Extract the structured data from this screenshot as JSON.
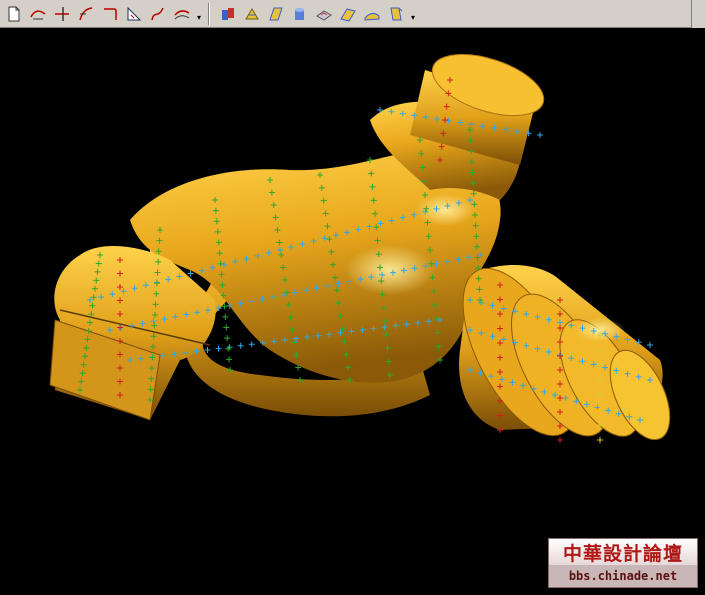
{
  "toolbar": {
    "left_tools": [
      {
        "icon": "new-sketch-icon"
      },
      {
        "icon": "curve-through-points-icon"
      },
      {
        "icon": "trim-curve-icon"
      },
      {
        "icon": "fillet-curve-icon"
      },
      {
        "icon": "corner-curve-icon"
      },
      {
        "icon": "project-curve-icon"
      },
      {
        "icon": "spline-icon"
      },
      {
        "icon": "offset-curve-icon"
      }
    ],
    "right_tools": [
      {
        "icon": "extrude-icon"
      },
      {
        "icon": "loft-surface-icon"
      },
      {
        "icon": "sweep-surface-icon"
      },
      {
        "icon": "solid-body-icon"
      },
      {
        "icon": "shell-icon"
      },
      {
        "icon": "blend-surface-icon"
      },
      {
        "icon": "boundary-surface-icon"
      },
      {
        "icon": "offset-surface-icon"
      }
    ],
    "overflow_label": "▾"
  },
  "viewport": {
    "background": "#000000",
    "model_color": "#e8a71c",
    "point_colors": [
      "#2fa8e8",
      "#2ea82e",
      "#d41e1e",
      "#e0c830"
    ]
  },
  "watermark": {
    "title": "中華設計論壇",
    "url": "bbs.chinade.net"
  }
}
